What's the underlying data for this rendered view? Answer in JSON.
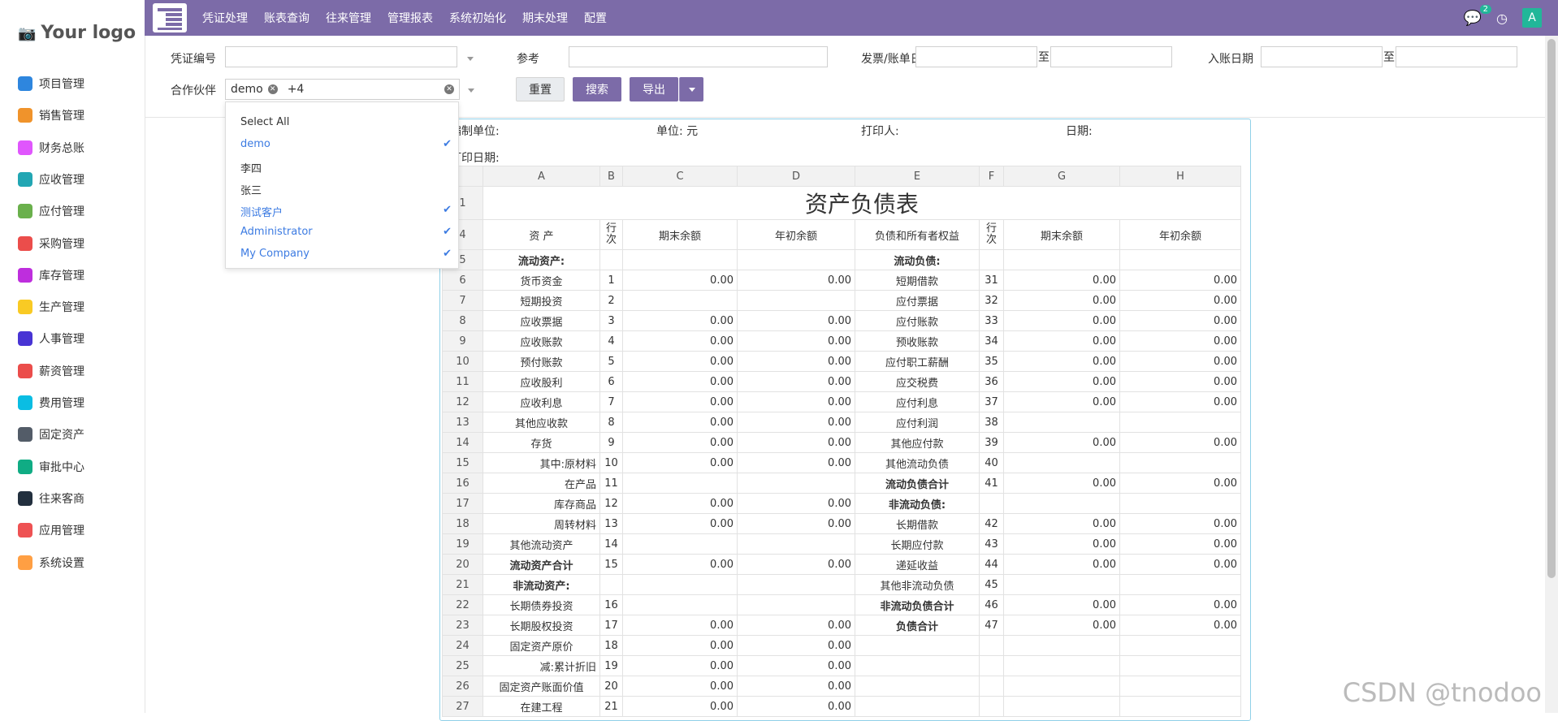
{
  "logo": "Your logo",
  "sidebar": [
    {
      "label": "项目管理",
      "icon": "check-icon",
      "color": "#2e86de"
    },
    {
      "label": "销售管理",
      "icon": "bar-chart-icon",
      "color": "#f0932b"
    },
    {
      "label": "财务总账",
      "icon": "tools-icon",
      "color": "#e056fd"
    },
    {
      "label": "应收管理",
      "icon": "download-icon",
      "color": "#22a6b3"
    },
    {
      "label": "应付管理",
      "icon": "upload-icon",
      "color": "#6ab04c"
    },
    {
      "label": "采购管理",
      "icon": "list-icon",
      "color": "#eb4d4b"
    },
    {
      "label": "库存管理",
      "icon": "box-icon",
      "color": "#be2edd"
    },
    {
      "label": "生产管理",
      "icon": "factory-icon",
      "color": "#f9ca24"
    },
    {
      "label": "人事管理",
      "icon": "person-icon",
      "color": "#4834d4"
    },
    {
      "label": "薪资管理",
      "icon": "wallet-icon",
      "color": "#eb4d4b"
    },
    {
      "label": "费用管理",
      "icon": "user-money-icon",
      "color": "#0abde3"
    },
    {
      "label": "固定资产",
      "icon": "house-icon",
      "color": "#535c68"
    },
    {
      "label": "审批中心",
      "icon": "person-check-icon",
      "color": "#10ac84"
    },
    {
      "label": "往来客商",
      "icon": "contacts-icon",
      "color": "#222f3e"
    },
    {
      "label": "应用管理",
      "icon": "apps-icon",
      "color": "#ee5253"
    },
    {
      "label": "系统设置",
      "icon": "settings-icon",
      "color": "#ff9f43"
    }
  ],
  "topmenu": [
    "凭证处理",
    "账表查询",
    "往来管理",
    "管理报表",
    "系统初始化",
    "期末处理",
    "配置"
  ],
  "topbar": {
    "chat_badge": "2",
    "avatar": "A"
  },
  "filters": {
    "voucher_no": "凭证编号",
    "reference": "参考",
    "invoice_date": "发票/账单日期",
    "to1": "至",
    "entry_date": "入账日期",
    "to2": "至",
    "partner": "合作伙伴",
    "partner_tag": "demo",
    "partner_more": "+4",
    "reset": "重置",
    "search": "搜索",
    "export": "导出"
  },
  "dropdown": [
    {
      "label": "Select All",
      "selected": false
    },
    {
      "label": "demo",
      "selected": true
    },
    {
      "label": "李四",
      "selected": false
    },
    {
      "label": "张三",
      "selected": false
    },
    {
      "label": "测试客户",
      "selected": true
    },
    {
      "label": "Administrator",
      "selected": true
    },
    {
      "label": "My Company",
      "selected": true
    }
  ],
  "report": {
    "meta": {
      "unit_org": "编制单位:",
      "unit": "单位: 元",
      "printer": "打印人:",
      "date": "日期:",
      "print_date": "打印日期:"
    },
    "cols": [
      "A",
      "B",
      "C",
      "D",
      "E",
      "F",
      "G",
      "H"
    ],
    "title": "资产负债表",
    "headers": [
      "资 产",
      "行次",
      "期末余额",
      "年初余额",
      "负债和所有者权益",
      "行次",
      "期末余额",
      "年初余额"
    ],
    "rows": [
      [
        "5",
        "流动资产:",
        "",
        "",
        "",
        "流动负债:",
        "",
        "",
        ""
      ],
      [
        "6",
        "货币资金",
        "1",
        "0.00",
        "0.00",
        "短期借款",
        "31",
        "0.00",
        "0.00"
      ],
      [
        "7",
        "短期投资",
        "2",
        "",
        "",
        "应付票据",
        "32",
        "0.00",
        "0.00"
      ],
      [
        "8",
        "应收票据",
        "3",
        "0.00",
        "0.00",
        "应付账款",
        "33",
        "0.00",
        "0.00"
      ],
      [
        "9",
        "应收账款",
        "4",
        "0.00",
        "0.00",
        "预收账款",
        "34",
        "0.00",
        "0.00"
      ],
      [
        "10",
        "预付账款",
        "5",
        "0.00",
        "0.00",
        "应付职工薪酬",
        "35",
        "0.00",
        "0.00"
      ],
      [
        "11",
        "应收股利",
        "6",
        "0.00",
        "0.00",
        "应交税费",
        "36",
        "0.00",
        "0.00"
      ],
      [
        "12",
        "应收利息",
        "7",
        "0.00",
        "0.00",
        "应付利息",
        "37",
        "0.00",
        "0.00"
      ],
      [
        "13",
        "其他应收款",
        "8",
        "0.00",
        "0.00",
        "应付利润",
        "38",
        "",
        ""
      ],
      [
        "14",
        "存货",
        "9",
        "0.00",
        "0.00",
        "其他应付款",
        "39",
        "0.00",
        "0.00"
      ],
      [
        "15",
        "其中:原材料",
        "10",
        "0.00",
        "0.00",
        "其他流动负债",
        "40",
        "",
        ""
      ],
      [
        "16",
        "在产品",
        "11",
        "",
        "",
        "流动负债合计",
        "41",
        "0.00",
        "0.00"
      ],
      [
        "17",
        "库存商品",
        "12",
        "0.00",
        "0.00",
        "非流动负债:",
        "",
        "",
        ""
      ],
      [
        "18",
        "周转材料",
        "13",
        "0.00",
        "0.00",
        "长期借款",
        "42",
        "0.00",
        "0.00"
      ],
      [
        "19",
        "其他流动资产",
        "14",
        "",
        "",
        "长期应付款",
        "43",
        "0.00",
        "0.00"
      ],
      [
        "20",
        "流动资产合计",
        "15",
        "0.00",
        "0.00",
        "递延收益",
        "44",
        "0.00",
        "0.00"
      ],
      [
        "21",
        "非流动资产:",
        "",
        "",
        "",
        "其他非流动负债",
        "45",
        "",
        ""
      ],
      [
        "22",
        "长期债券投资",
        "16",
        "",
        "",
        "非流动负债合计",
        "46",
        "0.00",
        "0.00"
      ],
      [
        "23",
        "长期股权投资",
        "17",
        "0.00",
        "0.00",
        "负债合计",
        "47",
        "0.00",
        "0.00"
      ],
      [
        "24",
        "固定资产原价",
        "18",
        "0.00",
        "0.00",
        "",
        "",
        "",
        ""
      ],
      [
        "25",
        "减:累计折旧",
        "19",
        "0.00",
        "0.00",
        "",
        "",
        "",
        ""
      ],
      [
        "26",
        "固定资产账面价值",
        "20",
        "0.00",
        "0.00",
        "",
        "",
        "",
        ""
      ],
      [
        "27",
        "在建工程",
        "21",
        "0.00",
        "0.00",
        "",
        "",
        "",
        ""
      ]
    ]
  },
  "watermark": "CSDN @tnodoo"
}
